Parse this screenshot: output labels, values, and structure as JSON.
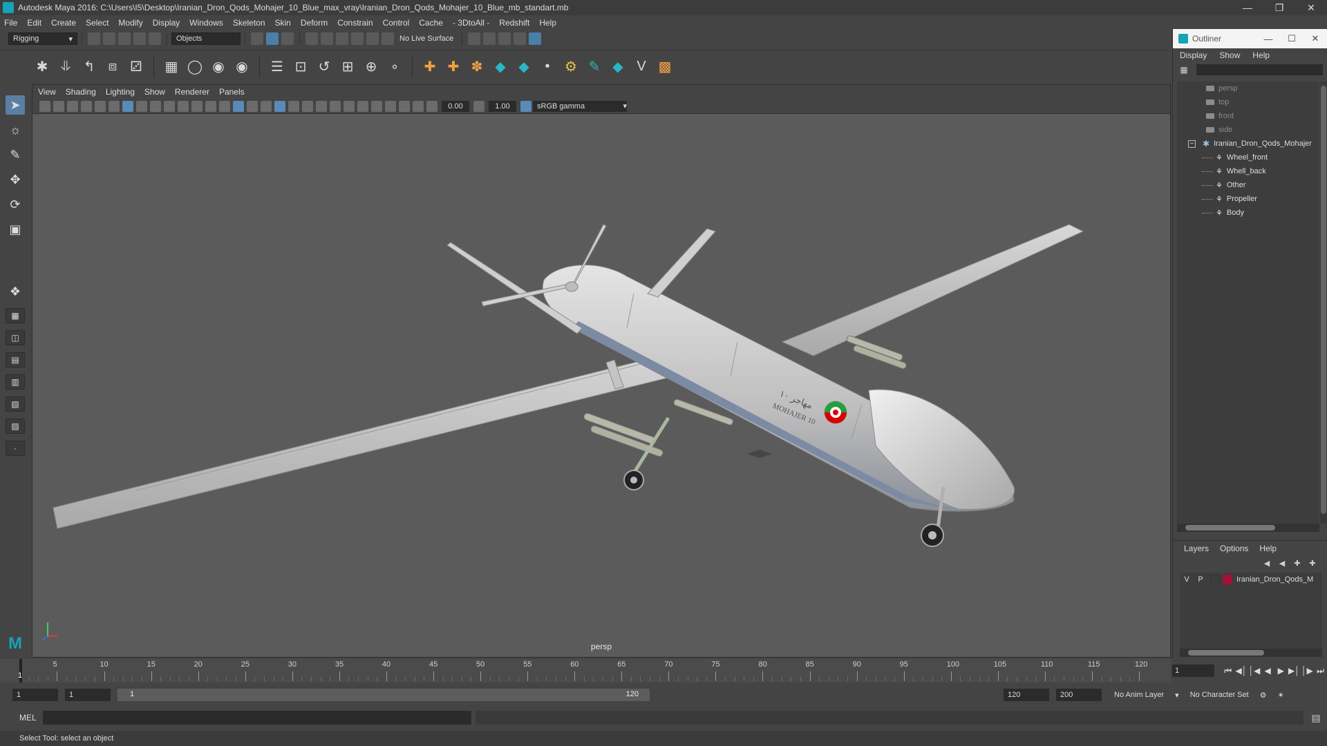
{
  "window": {
    "title": "Autodesk Maya 2016: C:\\Users\\I5\\Desktop\\Iranian_Dron_Qods_Mohajer_10_Blue_max_vray\\Iranian_Dron_Qods_Mohajer_10_Blue_mb_standart.mb"
  },
  "menubar": [
    "File",
    "Edit",
    "Create",
    "Select",
    "Modify",
    "Display",
    "Windows",
    "Skeleton",
    "Skin",
    "Deform",
    "Constrain",
    "Control",
    "Cache",
    "- 3DtoAll -",
    "Redshift",
    "Help"
  ],
  "statusline": {
    "mode": "Rigging",
    "selection_mode": "Objects",
    "live_surface": "No Live Surface"
  },
  "viewport": {
    "menu": [
      "View",
      "Shading",
      "Lighting",
      "Show",
      "Renderer",
      "Panels"
    ],
    "exposure": "0.00",
    "gamma": "1.00",
    "color_space": "sRGB gamma",
    "camera_label": "persp",
    "decals": {
      "name_farsi": "مهاجر ۱۰",
      "name_latin": "MOHAJER 10"
    }
  },
  "outliner": {
    "title": "Outliner",
    "menu": [
      "Display",
      "Show",
      "Help"
    ],
    "cameras": [
      "persp",
      "top",
      "front",
      "side"
    ],
    "group": "Iranian_Dron_Qods_Mohajer",
    "children": [
      "Wheel_front",
      "Whell_back",
      "Other",
      "Propeller",
      "Body"
    ]
  },
  "layers": {
    "menu": [
      "Layers",
      "Options",
      "Help"
    ],
    "rows": [
      {
        "v": "V",
        "p": "P",
        "name": "Iranian_Dron_Qods_M",
        "color": "#a11238"
      }
    ]
  },
  "timeline": {
    "ticks": [
      5,
      10,
      15,
      20,
      25,
      30,
      35,
      40,
      45,
      50,
      55,
      60,
      65,
      70,
      75,
      80,
      85,
      90,
      95,
      100,
      105,
      110,
      115,
      120
    ],
    "current_frame": "1",
    "current_frame_field": "1"
  },
  "range": {
    "start": "1",
    "playback_start": "1",
    "bar_left": "1",
    "bar_right": "120",
    "playback_end": "120",
    "end": "200",
    "anim_layer": "No Anim Layer",
    "character_set": "No Character Set"
  },
  "cmdline": {
    "label": "MEL"
  },
  "helpline": {
    "text": "Select Tool: select an object"
  }
}
